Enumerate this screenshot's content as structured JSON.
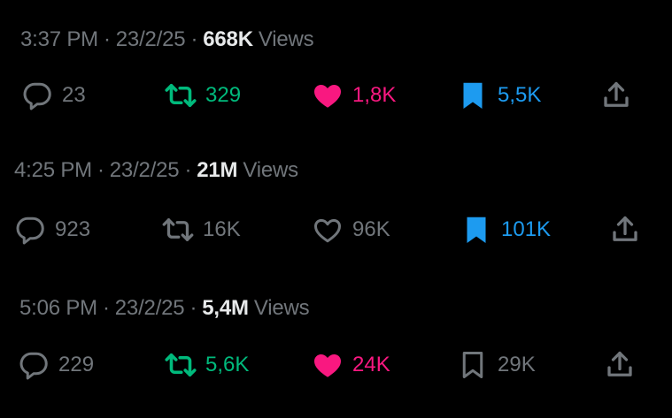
{
  "colors": {
    "muted": "#71767b",
    "bright": "#e7e9ea",
    "repost_active": "#00ba7c",
    "like_active": "#f91880",
    "bookmark_active": "#1d9bf0",
    "background": "#000000"
  },
  "views_suffix": "Views",
  "separator": "·",
  "posts": [
    {
      "time": "3:37 PM",
      "date": "23/2/25",
      "views": "668K",
      "replies": "23",
      "reposts": "329",
      "likes": "1,8K",
      "bookmarks": "5,5K",
      "reposted": true,
      "liked": true,
      "bookmarked": true
    },
    {
      "time": "4:25 PM",
      "date": "23/2/25",
      "views": "21M",
      "replies": "923",
      "reposts": "16K",
      "likes": "96K",
      "bookmarks": "101K",
      "reposted": false,
      "liked": false,
      "bookmarked": true
    },
    {
      "time": "5:06 PM",
      "date": "23/2/25",
      "views": "5,4M",
      "replies": "229",
      "reposts": "5,6K",
      "likes": "24K",
      "bookmarks": "29K",
      "reposted": true,
      "liked": true,
      "bookmarked": false
    }
  ],
  "icons": {
    "reply": "reply-icon",
    "repost": "repost-icon",
    "like": "heart-icon",
    "bookmark": "bookmark-icon",
    "share": "share-icon"
  }
}
